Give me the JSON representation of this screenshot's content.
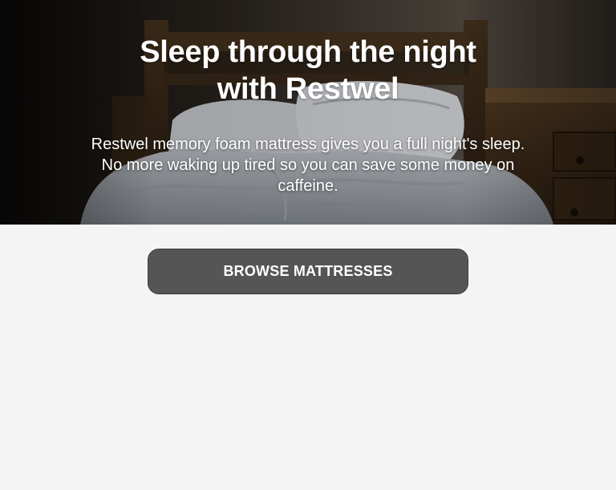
{
  "hero": {
    "title_line1": "Sleep through the night",
    "title_line2": "with Restwel",
    "subtitle": "Restwel memory foam mattress gives you a full night's sleep. No more waking up tired so you can save some money on caffeine."
  },
  "cta": {
    "label": "BROWSE MATTRESSES"
  },
  "colors": {
    "page_background": "#f4f4f4",
    "button_background": "#555555",
    "button_text": "#ffffff",
    "hero_text": "#ffffff"
  }
}
